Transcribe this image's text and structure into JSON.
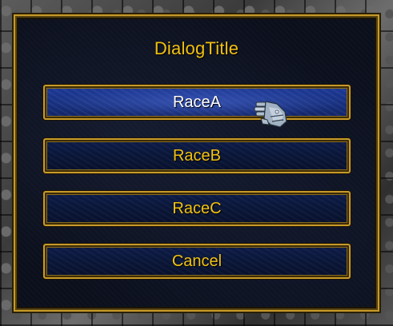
{
  "dialog": {
    "title": "DialogTitle",
    "buttons": [
      {
        "label": "RaceA",
        "highlighted": true
      },
      {
        "label": "RaceB",
        "highlighted": false
      },
      {
        "label": "RaceC",
        "highlighted": false
      },
      {
        "label": "Cancel",
        "highlighted": false
      }
    ]
  },
  "cursor": {
    "icon": "gauntlet-cursor-icon"
  },
  "colors": {
    "accent_gold": "#f2c20f",
    "border_gold": "#c79a2a",
    "button_blue": "#0a1638",
    "button_highlight_blue": "#17307e",
    "panel_dark": "#0b0f1c"
  }
}
